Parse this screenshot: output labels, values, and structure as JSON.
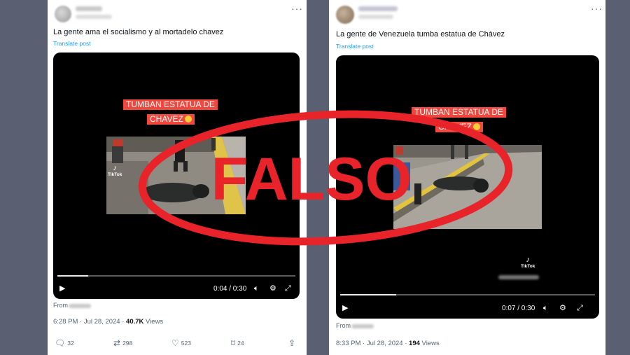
{
  "left_post": {
    "text": "La gente ama el socialismo y al mortadelo chavez",
    "translate": "Translate post",
    "video": {
      "caption_line1": "TUMBAN ESTATUA DE",
      "caption_line2": "CHAVEZ",
      "watermark": "TikTok",
      "time": "0:04 / 0:30",
      "progress": 0.13
    },
    "from_label": "From",
    "timestamp": "6:28 PM · Jul 28, 2024 · ",
    "views_count": "40.7K",
    "views_label": " Views",
    "stats": {
      "replies": "32",
      "reposts": "298",
      "likes": "523",
      "bookmarks": "24"
    }
  },
  "right_post": {
    "text": "La gente de Venezuela tumba estatua de Chávez",
    "translate": "Translate post",
    "video": {
      "caption_line1": "TUMBAN ESTATUA DE",
      "caption_line2": "CHAVEZ",
      "watermark": "TikTok",
      "time": "0:07 / 0:30",
      "progress": 0.22
    },
    "from_label": "From",
    "timestamp": "8:33 PM · Jul 28, 2024 · ",
    "views_count": "194",
    "views_label": " Views"
  },
  "stamp": {
    "text": "FALSO",
    "color": "#e8232a"
  },
  "icons": [
    "more-icon",
    "play-icon",
    "volume-icon",
    "settings-icon",
    "fullscreen-icon",
    "reply-icon",
    "repost-icon",
    "like-icon",
    "bookmark-icon",
    "share-icon"
  ]
}
